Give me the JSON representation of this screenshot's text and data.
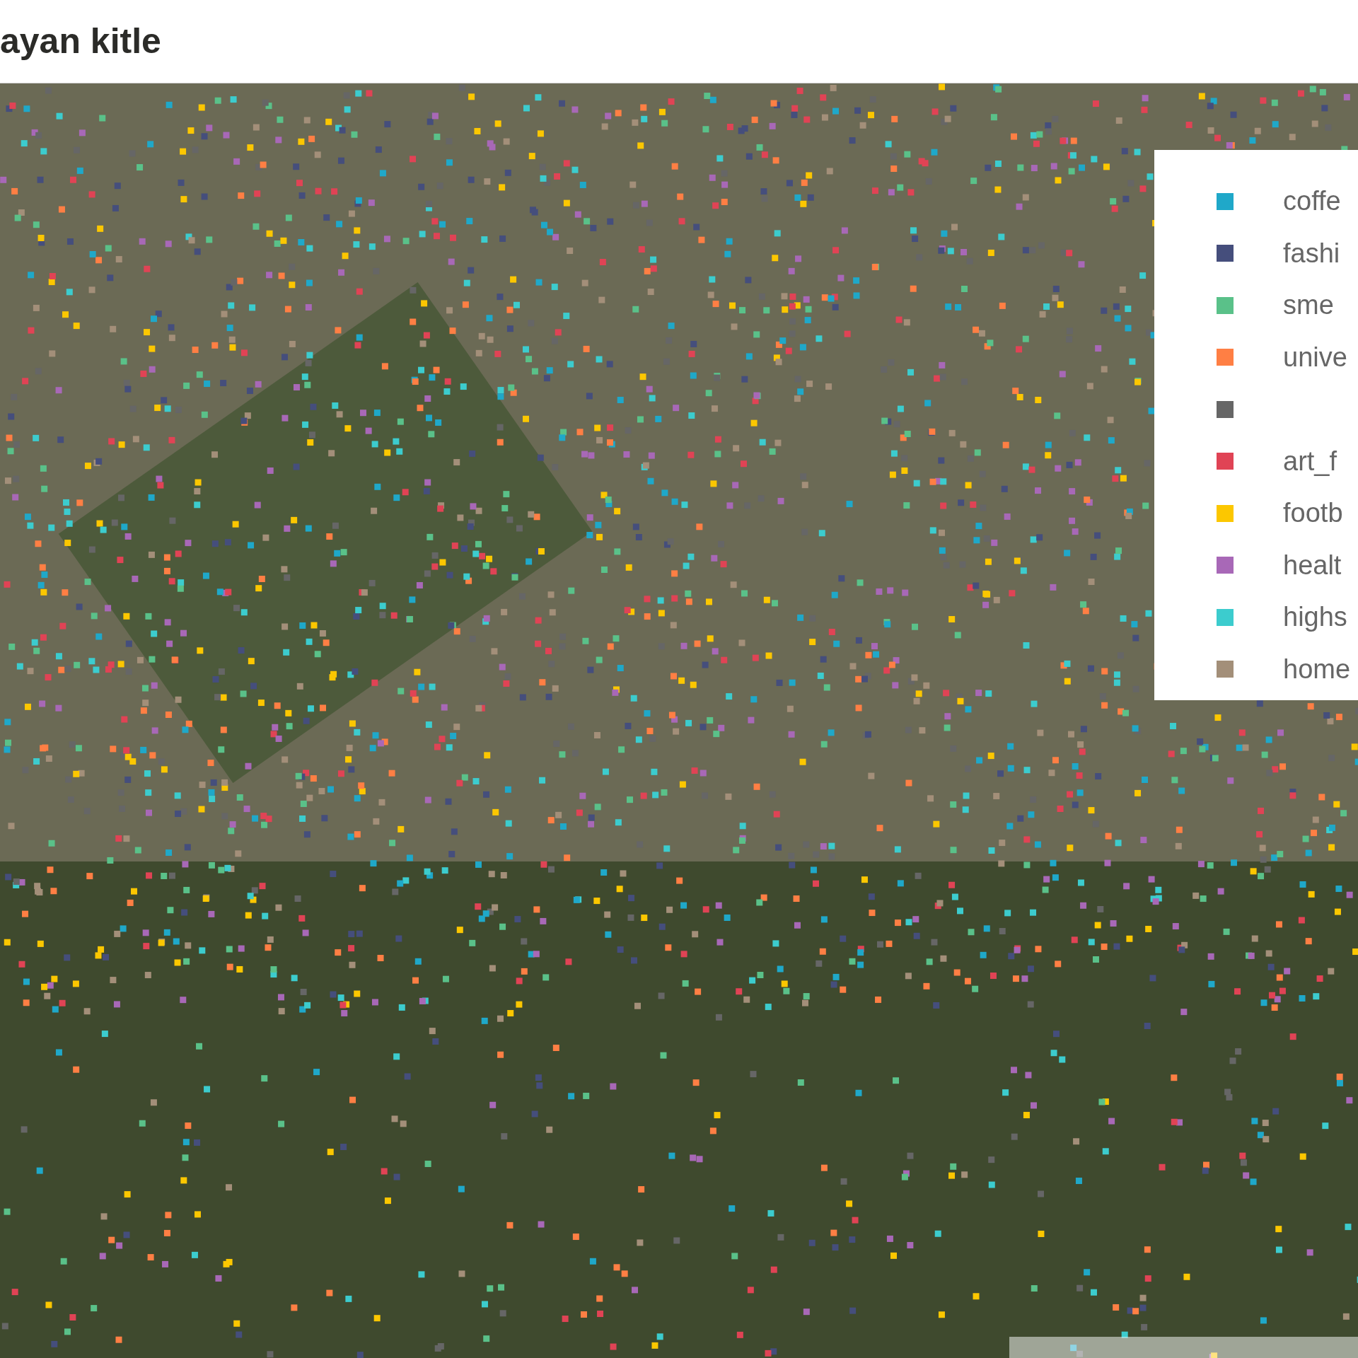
{
  "header": {
    "title": "ayan kitle"
  },
  "legend": {
    "items": [
      {
        "label": "coffe",
        "color": "#1fa8c9"
      },
      {
        "label": "fashi",
        "color": "#454e7c"
      },
      {
        "label": "sme",
        "color": "#5ac189"
      },
      {
        "label": "unive",
        "color": "#ff7f44"
      },
      {
        "color": "#666666"
      },
      {
        "label": "art_f",
        "color": "#e04355"
      },
      {
        "label": "footb",
        "color": "#fcc700"
      },
      {
        "label": "healt",
        "color": "#a868b7"
      },
      {
        "label": "highs",
        "color": "#3cccce"
      },
      {
        "label": "home",
        "color": "#a38f79"
      }
    ]
  }
}
